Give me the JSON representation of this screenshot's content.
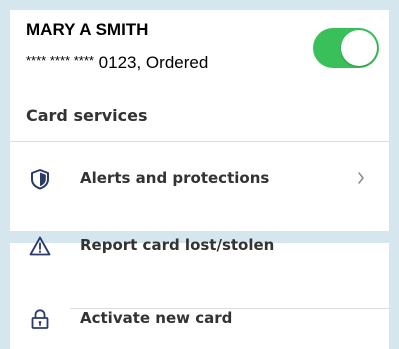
{
  "card": {
    "holder_name": "MARY A SMITH",
    "number_mask": "**** **** ****",
    "number_tail": "0123, Ordered",
    "toggle_on": true
  },
  "services": {
    "title": "Card services",
    "items": [
      {
        "label": "Alerts and protections",
        "icon": "shield-icon",
        "has_chevron": true
      },
      {
        "label": "Report card lost/stolen",
        "icon": "warning-triangle-icon",
        "has_chevron": false
      },
      {
        "label": "Activate new card",
        "icon": "lock-icon",
        "has_chevron": false
      }
    ]
  },
  "colors": {
    "background": "#d5e6ee",
    "toggle_on": "#3ac05a",
    "icon": "#2a3a6a",
    "text": "#333333"
  }
}
